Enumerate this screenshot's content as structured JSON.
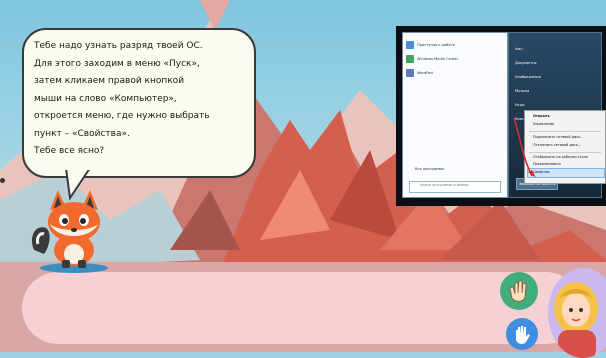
{
  "dialog": {
    "lines": [
      "Тебе надо узнать разряд твоей ОС.",
      "Для этого заходим в меню «Пуск»,",
      "затем кликаем правой кнопкой",
      "мыши на слово «Компьютер»,",
      "откроется меню, где нужно выбрать",
      "пункт – «Свойства».",
      "Тебе все ясно?"
    ]
  },
  "os_screenshot": {
    "start_menu": {
      "programs": [
        "Приступая к работе",
        "Windows Media Center",
        "WordPad"
      ],
      "all_programs": "Все программы",
      "search_placeholder": "Найти программы и файлы",
      "right_links": [
        "Ivan",
        "Документы",
        "Изображения",
        "Музыка",
        "Игры",
        "Компьютер"
      ],
      "shutdown": "Завершение работы"
    },
    "context_menu": {
      "items": [
        "Открыть",
        "Управление",
        "Подключить сетевой диск...",
        "Отключить сетевой диск...",
        "Отображать на рабочем столе",
        "Переименовать",
        "Свойства"
      ]
    }
  },
  "colors": {
    "sky": "#9fd1e2",
    "bubble_bg": "#fbfbf2",
    "bubble_border": "#3a3a3a",
    "panel": "#ffe0e6",
    "hand_button": "#3fae7a",
    "stop_button": "#3f8ee0",
    "avatar_bg": "#cbb8ee",
    "arrow": "#d42a2a"
  },
  "icons": {
    "fox": "fox-mascot-icon",
    "hand": "raised-hand-icon",
    "stop": "stop-hand-icon",
    "avatar": "girl-avatar-icon"
  }
}
